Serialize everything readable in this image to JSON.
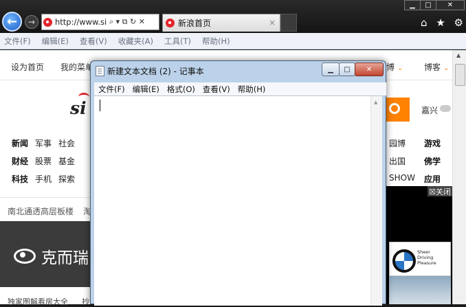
{
  "browser": {
    "address_url": "http://www.si...",
    "address_controls": "⌕ ▾ ⧉ ↻ ✕",
    "tab_active_title": "新浪首页",
    "tab_close": "×",
    "window_controls": {
      "min": "▁",
      "max": "□",
      "close": "✕"
    },
    "right_icons": {
      "home": "⌂",
      "favorites": "★",
      "tools": "⚙"
    },
    "menu": [
      "文件(F)",
      "编辑(E)",
      "查看(V)",
      "收藏夹(A)",
      "工具(T)",
      "帮助(H)"
    ]
  },
  "sina": {
    "top_left_links": [
      "设为首页",
      "我的菜单"
    ],
    "top_right_links": [
      "博",
      "博客"
    ],
    "logo_text": "si",
    "city": "嘉兴",
    "nav_left": [
      [
        "新闻",
        "军事",
        "社会"
      ],
      [
        "财经",
        "股票",
        "基金"
      ],
      [
        "科技",
        "手机",
        "探索"
      ]
    ],
    "nav_right_mid": [
      "园博",
      "出国",
      "SHOW"
    ],
    "nav_right": [
      "游戏",
      "佛学",
      "应用"
    ],
    "gray_bar_text": "南北通透高层板楼",
    "gray_bar_extra": "淘",
    "ad_brand": "克而瑞",
    "bottom_left_text": "独家图解看房大全",
    "bottom_left_extra": "抄",
    "close_ad": "☒关闭",
    "bmw_slogan": [
      "Sheer",
      "Driving",
      "Pleasure"
    ]
  },
  "notepad": {
    "title": "新建文本文档 (2) - 记事本",
    "menu": [
      "文件(F)",
      "编辑(E)",
      "格式(O)",
      "查看(V)",
      "帮助(H)"
    ],
    "content": "",
    "controls": {
      "min": "▁",
      "max": "□",
      "close": "✕"
    }
  }
}
